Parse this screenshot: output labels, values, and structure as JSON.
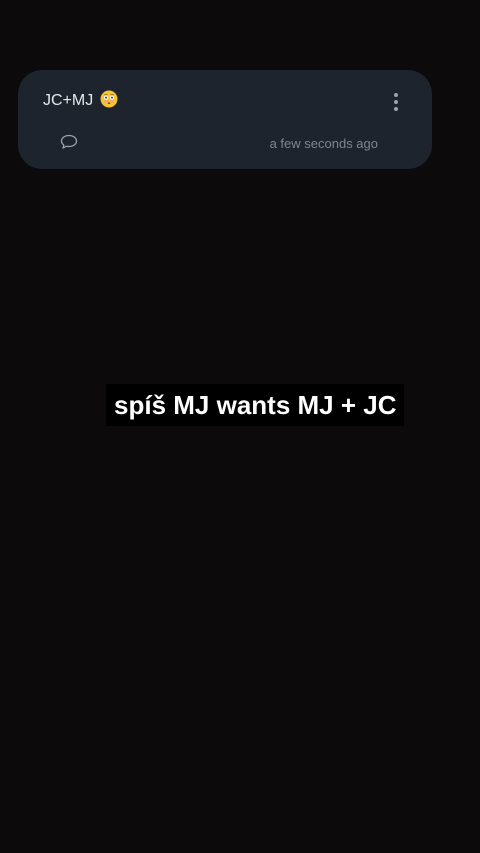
{
  "post": {
    "title": "JC+MJ",
    "title_emoji": "flushed-face",
    "timestamp": "a few seconds ago",
    "more_icon": "vertical-ellipsis-icon",
    "comment_icon": "speech-bubble-icon"
  },
  "overlay": {
    "caption": "spíš MJ wants MJ + JC"
  },
  "colors": {
    "background": "#0c0a0b",
    "card": "#1d242d",
    "title_text": "#e6e9ec",
    "meta_text": "#7d8690",
    "caption_bg": "#000000",
    "caption_text": "#ffffff"
  }
}
